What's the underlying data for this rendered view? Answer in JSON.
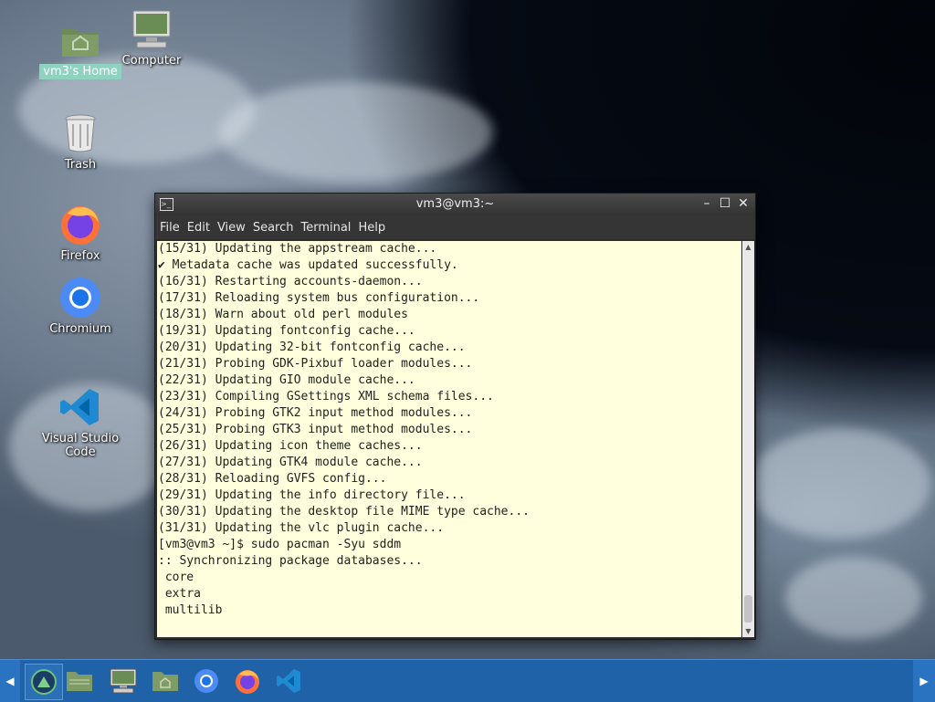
{
  "desktop": {
    "icons": [
      {
        "label": "vm3's Home"
      },
      {
        "label": "Computer"
      },
      {
        "label": "Trash"
      },
      {
        "label": "Firefox"
      },
      {
        "label": "Chromium"
      },
      {
        "label": "Visual Studio Code"
      }
    ]
  },
  "terminal": {
    "title": "vm3@vm3:~",
    "menu": [
      "File",
      "Edit",
      "View",
      "Search",
      "Terminal",
      "Help"
    ],
    "lines": [
      "(15/31) Updating the appstream cache...",
      "✔ Metadata cache was updated successfully.",
      "(16/31) Restarting accounts-daemon...",
      "(17/31) Reloading system bus configuration...",
      "(18/31) Warn about old perl modules",
      "(19/31) Updating fontconfig cache...",
      "(20/31) Updating 32-bit fontconfig cache...",
      "(21/31) Probing GDK-Pixbuf loader modules...",
      "(22/31) Updating GIO module cache...",
      "(23/31) Compiling GSettings XML schema files...",
      "(24/31) Probing GTK2 input method modules...",
      "(25/31) Probing GTK3 input method modules...",
      "(26/31) Updating icon theme caches...",
      "(27/31) Updating GTK4 module cache...",
      "(28/31) Reloading GVFS config...",
      "(29/31) Updating the info directory file...",
      "(30/31) Updating the desktop file MIME type cache...",
      "(31/31) Updating the vlc plugin cache...",
      "[vm3@vm3 ~]$ sudo pacman -Syu sddm",
      ":: Synchronizing package databases...",
      " core",
      " extra",
      " multilib"
    ],
    "window_buttons": {
      "minimize": "–",
      "maximize": "☐",
      "close": "✕"
    }
  },
  "taskbar": {
    "left_arrow": "◀",
    "right_arrow": "▶"
  },
  "colors": {
    "terminal_bg": "#ffffdd",
    "taskbar": "#1f62a8",
    "selection": "#8fd2c0"
  }
}
